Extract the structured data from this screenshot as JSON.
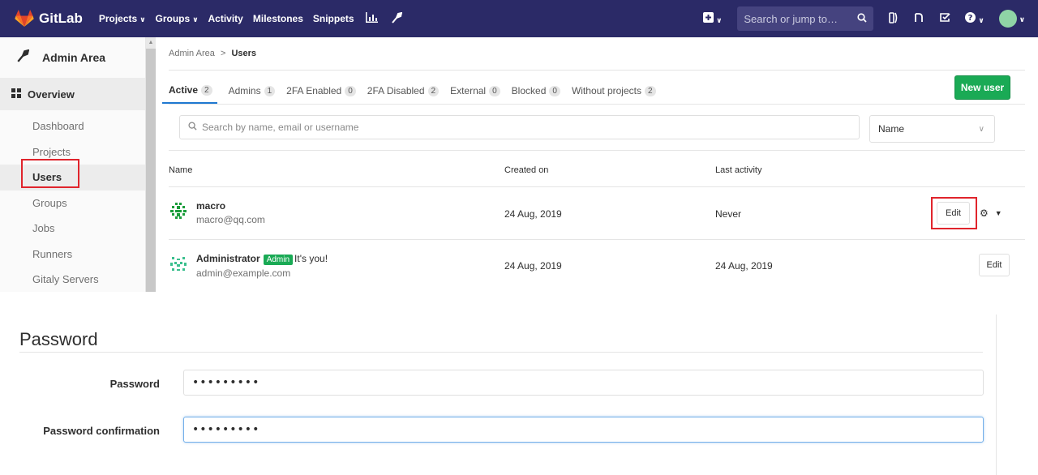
{
  "navbar": {
    "brand": "GitLab",
    "items": [
      {
        "label": "Projects",
        "dropdown": true
      },
      {
        "label": "Groups",
        "dropdown": true
      },
      {
        "label": "Activity",
        "dropdown": false
      },
      {
        "label": "Milestones",
        "dropdown": false
      },
      {
        "label": "Snippets",
        "dropdown": false
      }
    ],
    "search_placeholder": "Search or jump to…",
    "icons": [
      "chart-icon",
      "wrench-icon",
      "plus-square-icon",
      "search-icon",
      "issues-icon",
      "merge-request-icon",
      "todo-icon",
      "help-icon",
      "user-avatar-icon"
    ]
  },
  "sidebar": {
    "title": "Admin Area",
    "section": "Overview",
    "items": [
      "Dashboard",
      "Projects",
      "Users",
      "Groups",
      "Jobs",
      "Runners",
      "Gitaly Servers"
    ],
    "active_item": "Users"
  },
  "breadcrumb": {
    "parent": "Admin Area",
    "separator": ">",
    "current": "Users"
  },
  "tabs": [
    {
      "label": "Active",
      "count": "2",
      "active": true
    },
    {
      "label": "Admins",
      "count": "1"
    },
    {
      "label": "2FA Enabled",
      "count": "0"
    },
    {
      "label": "2FA Disabled",
      "count": "2"
    },
    {
      "label": "External",
      "count": "0"
    },
    {
      "label": "Blocked",
      "count": "0"
    },
    {
      "label": "Without projects",
      "count": "2"
    }
  ],
  "new_user_label": "New user",
  "filter": {
    "placeholder": "Search by name, email or username",
    "sort_value": "Name"
  },
  "table": {
    "headers": {
      "name": "Name",
      "created": "Created on",
      "activity": "Last activity"
    },
    "rows": [
      {
        "name": "macro",
        "email": "macro@qq.com",
        "created": "24 Aug, 2019",
        "activity": "Never",
        "edit": "Edit"
      },
      {
        "name": "Administrator",
        "badge": "Admin",
        "note": "It's you!",
        "email": "admin@example.com",
        "created": "24 Aug, 2019",
        "activity": "24 Aug, 2019",
        "edit": "Edit"
      }
    ]
  },
  "password_section": {
    "title": "Password",
    "password_label": "Password",
    "password_value": "•••••••••",
    "confirm_label": "Password confirmation",
    "confirm_value": "•••••••••"
  },
  "colors": {
    "navbar": "#2b2a67",
    "primary_green": "#1aaa55",
    "highlight_red": "#e0242c",
    "focus_blue": "#73afea"
  }
}
